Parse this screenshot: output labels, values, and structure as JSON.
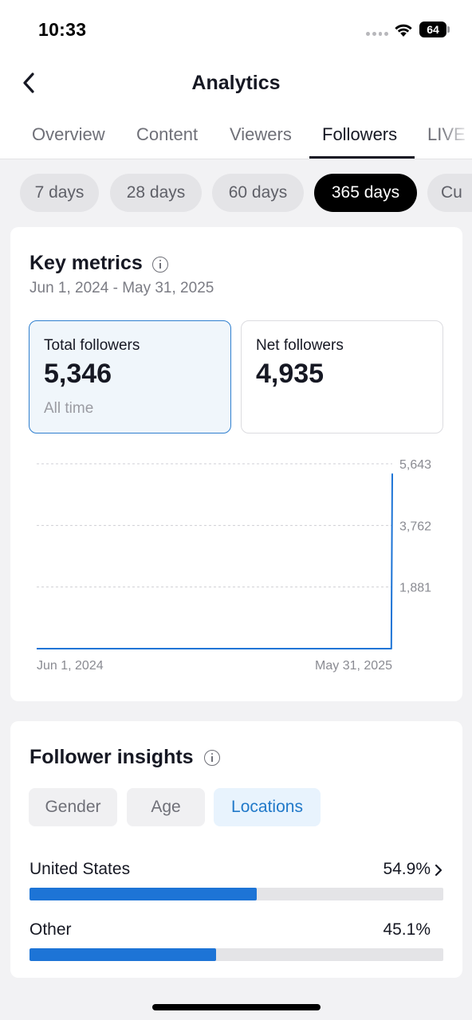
{
  "status_bar": {
    "time": "10:33",
    "battery": "64"
  },
  "header": {
    "title": "Analytics",
    "back_icon": "chevron-left-icon"
  },
  "tabs": [
    {
      "label": "Overview",
      "active": false
    },
    {
      "label": "Content",
      "active": false
    },
    {
      "label": "Viewers",
      "active": false
    },
    {
      "label": "Followers",
      "active": true
    },
    {
      "label": "LIVE",
      "active": false
    }
  ],
  "ranges": [
    {
      "label": "7 days",
      "active": false
    },
    {
      "label": "28 days",
      "active": false
    },
    {
      "label": "60 days",
      "active": false
    },
    {
      "label": "365 days",
      "active": true
    },
    {
      "label": "Cu",
      "active": false
    }
  ],
  "key_metrics": {
    "title": "Key metrics",
    "info_icon": "info-icon",
    "date_range": "Jun 1, 2024 - May 31, 2025",
    "total_followers": {
      "label": "Total followers",
      "value": "5,346",
      "sub": "All time"
    },
    "net_followers": {
      "label": "Net followers",
      "value": "4,935"
    }
  },
  "chart_data": {
    "type": "line",
    "title": "",
    "xlabel": "",
    "ylabel": "",
    "x_tick_labels": [
      "Jun 1, 2024",
      "May 31, 2025"
    ],
    "y_tick_labels": [
      "5,643",
      "3,762",
      "1,881"
    ],
    "ylim": [
      0,
      5643
    ],
    "grid": true,
    "series": [
      {
        "name": "",
        "color": "#1d74d6",
        "x": [
          "Jun 1, 2024",
          "May 30, 2025",
          "May 31, 2025"
        ],
        "y": [
          0,
          0,
          5346
        ]
      }
    ]
  },
  "follower_insights": {
    "title": "Follower insights",
    "info_icon": "info-icon",
    "tabs": [
      {
        "label": "Gender",
        "active": false
      },
      {
        "label": "Age",
        "active": false
      },
      {
        "label": "Locations",
        "active": true
      }
    ],
    "locations": [
      {
        "name": "United States",
        "percent_label": "54.9%",
        "percent": 54.9,
        "has_chevron": true
      },
      {
        "name": "Other",
        "percent_label": "45.1%",
        "percent": 45.1,
        "has_chevron": false
      }
    ]
  },
  "colors": {
    "accent": "#1d74d6",
    "selected_chip": "#000000",
    "background": "#f2f2f4"
  }
}
